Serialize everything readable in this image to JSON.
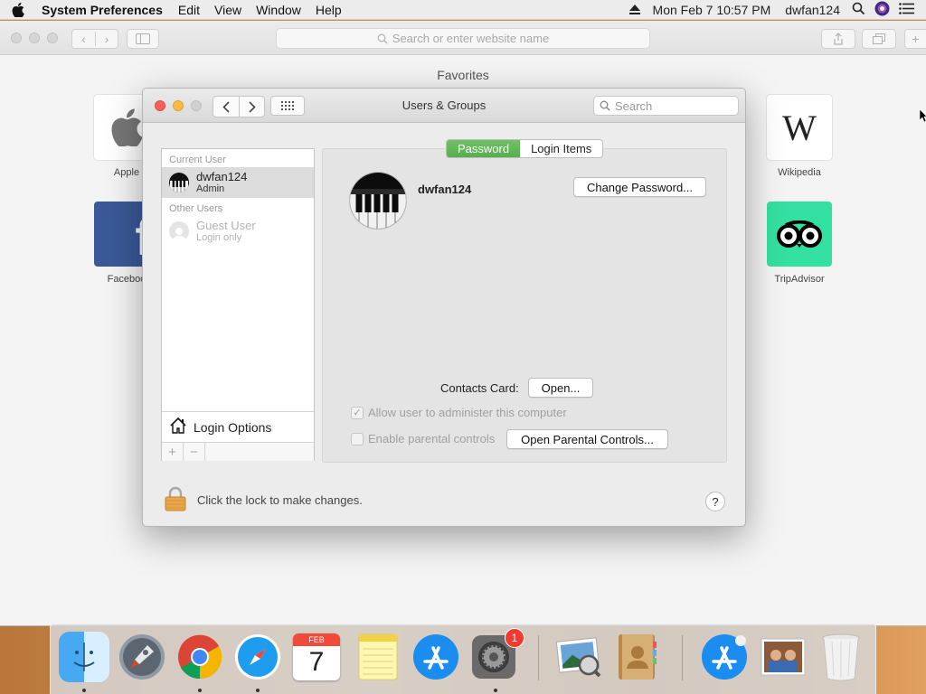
{
  "menubar": {
    "app_name": "System Preferences",
    "menus": [
      "Edit",
      "View",
      "Window",
      "Help"
    ],
    "datetime": "Mon Feb 7  10:57 PM",
    "user": "dwfan124"
  },
  "safari": {
    "url_placeholder": "Search or enter website name",
    "favorites_title": "Favorites",
    "favorites": [
      {
        "label": "Apple"
      },
      {
        "label": "Faceboo"
      },
      {
        "label": "Wikipedia",
        "tile_text": "W"
      },
      {
        "label": "TripAdvisor"
      }
    ]
  },
  "prefs": {
    "title": "Users & Groups",
    "search_placeholder": "Search",
    "current_user_header": "Current User",
    "other_users_header": "Other Users",
    "users": [
      {
        "name": "dwfan124",
        "role": "Admin",
        "selected": true
      },
      {
        "name": "Guest User",
        "role": "Login only",
        "selected": false
      }
    ],
    "login_options_label": "Login Options",
    "tabs": [
      {
        "label": "Password",
        "active": true
      },
      {
        "label": "Login Items",
        "active": false
      }
    ],
    "detail_user_name": "dwfan124",
    "change_password_label": "Change Password...",
    "contacts_card_label": "Contacts Card:",
    "open_button_label": "Open...",
    "allow_admin_label": "Allow user to administer this computer",
    "allow_admin_checked": true,
    "parental_controls_label": "Enable parental controls",
    "parental_controls_checked": false,
    "open_parental_label": "Open Parental Controls...",
    "lock_text": "Click the lock to make changes.",
    "help_label": "?"
  },
  "dock": {
    "calendar_month": "FEB",
    "calendar_day": "7",
    "sysprefs_badge": "1",
    "items": [
      "Finder",
      "Launchpad",
      "Google Chrome",
      "Safari",
      "Calendar",
      "Notes",
      "App Store",
      "System Preferences",
      "Preview",
      "Contacts",
      "App Store",
      "Photos",
      "Trash"
    ]
  }
}
